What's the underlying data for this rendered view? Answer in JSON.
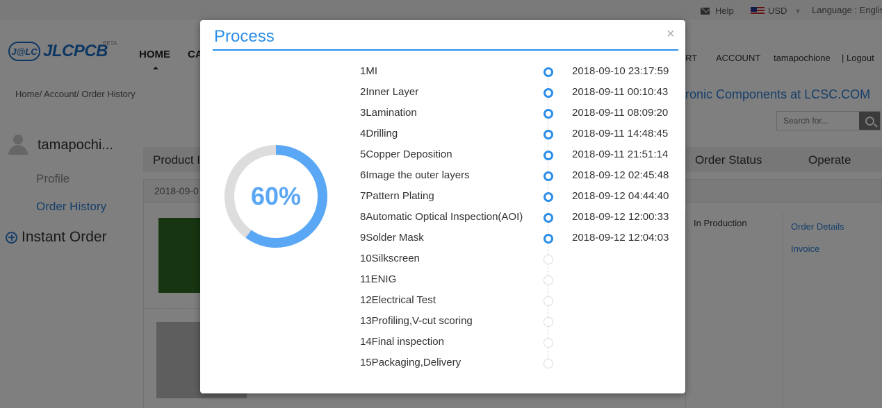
{
  "topbar": {
    "help": "Help",
    "currency": "USD",
    "language": "Language : English"
  },
  "header": {
    "logo_badge": "J@LC",
    "logo_text": "JLCPCB",
    "logo_beta": "BETA",
    "nav_home": "HOME",
    "nav_ca": "CA",
    "nav_rt": "RT",
    "nav_account": "ACCOUNT",
    "username": "tamapochione",
    "logout": "| Logout"
  },
  "breadcrumb": "Home/ Account/ Order History",
  "lcsc_banner": "ronic Components at LCSC.COM",
  "search": {
    "placeholder": "Search for..."
  },
  "sidebar": {
    "name": "tamapochi...",
    "profile": "Profile",
    "order_history": "Order History",
    "instant_order": "Instant Order"
  },
  "table": {
    "col_product": "Product I",
    "col_status": "Order Status",
    "col_operate": "Operate",
    "row_date": "2018-09-0",
    "status": "In Production",
    "order_details": "Order Details",
    "invoice": "Invoice"
  },
  "modal": {
    "title": "Process",
    "close": "×",
    "progress_label": "60%",
    "progress_fraction": 0.6,
    "accent_color": "#5aa7f5",
    "track_color": "#dddddd",
    "steps": [
      {
        "name": "1MI",
        "time": "2018-09-10 23:17:59",
        "done": true
      },
      {
        "name": "2Inner Layer",
        "time": "2018-09-11 00:10:43",
        "done": true
      },
      {
        "name": "3Lamination",
        "time": "2018-09-11 08:09:20",
        "done": true
      },
      {
        "name": "4Drilling",
        "time": "2018-09-11 14:48:45",
        "done": true
      },
      {
        "name": "5Copper Deposition",
        "time": "2018-09-11 21:51:14",
        "done": true
      },
      {
        "name": "6Image the outer layers",
        "time": "2018-09-12 02:45:48",
        "done": true
      },
      {
        "name": "7Pattern Plating",
        "time": "2018-09-12 04:44:40",
        "done": true
      },
      {
        "name": "8Automatic Optical Inspection(AOI)",
        "time": "2018-09-12 12:00:33",
        "done": true
      },
      {
        "name": "9Solder Mask",
        "time": "2018-09-12 12:04:03",
        "done": true
      },
      {
        "name": "10Silkscreen",
        "time": "",
        "done": false
      },
      {
        "name": "11ENIG",
        "time": "",
        "done": false
      },
      {
        "name": "12Electrical Test",
        "time": "",
        "done": false
      },
      {
        "name": "13Profiling,V-cut scoring",
        "time": "",
        "done": false
      },
      {
        "name": "14Final inspection",
        "time": "",
        "done": false
      },
      {
        "name": "15Packaging,Delivery",
        "time": "",
        "done": false
      }
    ]
  }
}
